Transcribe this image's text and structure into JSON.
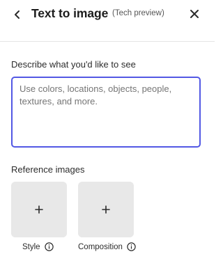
{
  "header": {
    "title": "Text to image",
    "badge": "(Tech preview)",
    "back_icon": "chevron-left-icon",
    "close_icon": "close-icon"
  },
  "prompt": {
    "label": "Describe what you'd like to see",
    "placeholder": "Use colors, locations, objects, people, textures, and more.",
    "value": ""
  },
  "reference": {
    "label": "Reference images",
    "items": [
      {
        "caption": "Style",
        "add_icon": "plus-icon",
        "info_icon": "info-icon"
      },
      {
        "caption": "Composition",
        "add_icon": "plus-icon",
        "info_icon": "info-icon"
      }
    ]
  },
  "colors": {
    "accent": "#5258e4",
    "tile": "#e8e8e8",
    "divider": "#e4e4e4",
    "text": "#222222"
  }
}
